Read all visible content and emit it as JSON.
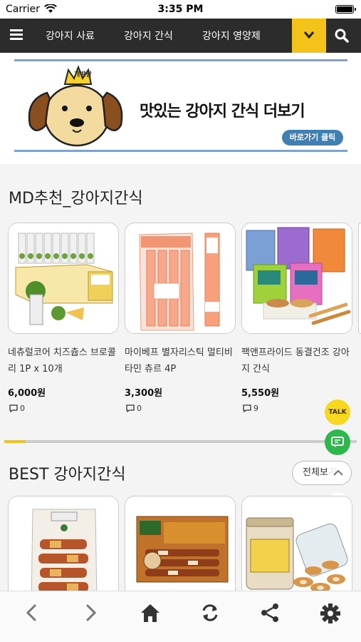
{
  "status_bar": {
    "carrier": "Carrier",
    "time": "3:35 PM"
  },
  "nav": {
    "items": [
      "강아지 사료",
      "강아지 간식",
      "강아지 영양제"
    ],
    "menu_icon": "hamburger-icon",
    "more_icon": "chevron-down-icon",
    "search_icon": "search-icon",
    "accent_color": "#f4c31a"
  },
  "banner": {
    "crown_text": "개발왕",
    "title": "맛있는 강아지 간식 더보기",
    "button": "바로가기 클릭"
  },
  "md_section": {
    "title": "MD추천_강아지간식",
    "products": [
      {
        "name": "네츄럴코어 치즈츕스 브로콜리 1P x 10개",
        "price": "6,000원",
        "comments": "0"
      },
      {
        "name": "마이베프 별자리스틱 멀티비타민 츄르 4P",
        "price": "3,300원",
        "comments": "0"
      },
      {
        "name": "팩앤프라이드 동결건조 강아지 간식",
        "price": "5,550원",
        "comments": "9"
      }
    ],
    "scroll_progress": 0.06
  },
  "best_section": {
    "title": "BEST 강아지간식",
    "view_all": "전체보기"
  },
  "floating": {
    "talk": "TALK",
    "chat_icon": "chat-icon"
  },
  "toolbar": {
    "icons": [
      "back-icon",
      "forward-icon",
      "home-icon",
      "refresh-icon",
      "share-icon",
      "settings-icon"
    ]
  }
}
